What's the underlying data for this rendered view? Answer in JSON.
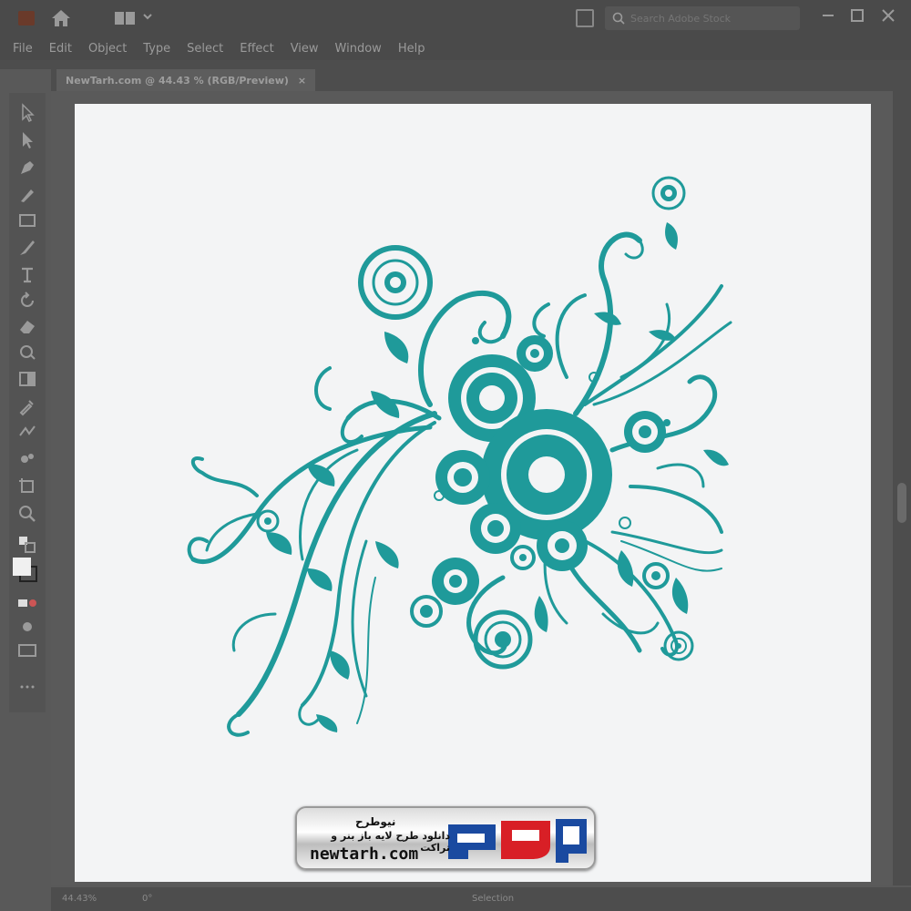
{
  "menu": [
    "File",
    "Edit",
    "Object",
    "Type",
    "Select",
    "Effect",
    "View",
    "Window",
    "Help"
  ],
  "search": {
    "placeholder": "Search Adobe Stock"
  },
  "document": {
    "tab_label": "NewTarh.com @ 44.43 % (RGB/Preview)",
    "close_glyph": "×"
  },
  "status": {
    "zoom": "44.43%",
    "rotation": "0°",
    "tool": "Selection"
  },
  "watermark": {
    "title": "نیوطرح",
    "subtitle": "دانلود طرح لایه باز بنر و تراکت",
    "url": "newtarh.com",
    "logo_text": "نیوطرح"
  },
  "colors": {
    "art": "#1f9a9a",
    "logo_red": "#d81f26",
    "logo_blue": "#1a4aa0"
  },
  "icons": [
    "ai-logo-icon",
    "home-icon",
    "workspace-icon",
    "search-icon",
    "minimize-icon",
    "maximize-icon",
    "close-icon"
  ]
}
